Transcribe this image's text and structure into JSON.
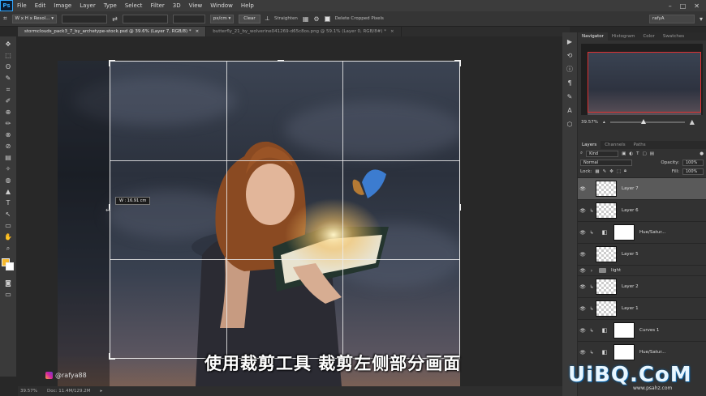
{
  "app": {
    "logo": "Ps"
  },
  "menu": [
    "File",
    "Edit",
    "Image",
    "Layer",
    "Type",
    "Select",
    "Filter",
    "3D",
    "View",
    "Window",
    "Help"
  ],
  "window_controls": [
    "–",
    "□",
    "✕"
  ],
  "options_bar": {
    "ratio_select": "W x H x Resol...",
    "unit_select": "px/cm",
    "clear_label": "Clear",
    "straighten_label": "Straighten",
    "delete_cropped_label": "Delete Cropped Pixels",
    "workspace_select": "rafyA"
  },
  "doc_tabs": [
    {
      "label": "stormclouds_pack3_7_by_archetype-stock.psd @ 39.6% (Layer 7, RGB/8) *",
      "close": "×",
      "active": true
    },
    {
      "label": "butterfly_21_by_wolverine041269-d65c8os.png @ 59.1% (Layer 0, RGB/8#) *",
      "close": "×",
      "active": false
    }
  ],
  "tools": [
    "✥",
    "⬚",
    "ʘ",
    "✎",
    "⌗",
    "✐",
    "⊕",
    "✏",
    "⊗",
    "⊘",
    "▤",
    "✧",
    "◍",
    "▲",
    "T",
    "↖",
    "▭",
    "✋",
    "⌕"
  ],
  "colors": {
    "foreground": "#f5b82e",
    "background": "#ffffff",
    "crop_border": "#e6e6e6",
    "nav_viewbox": "#e03030"
  },
  "canvas": {
    "width_tooltip": "W : 16.91 cm",
    "subtitle": "使用裁剪工具 裁剪左侧部分画面",
    "author_handle": "@rafya88"
  },
  "status": {
    "zoom": "39.57%",
    "doc": "Doc: 11.4M/129.2M"
  },
  "panel_strip_icons": [
    "play-icon",
    "history-icon",
    "info-icon",
    "paragraph-icon",
    "brush-icon",
    "character-icon",
    "path-icon"
  ],
  "panel_strip_glyphs": [
    "▶",
    "⟲",
    "ⓘ",
    "¶",
    "✎",
    "A",
    "⬡"
  ],
  "navigator": {
    "tabs": [
      "Navigator",
      "Histogram",
      "Color",
      "Swatches"
    ],
    "zoom_value": "39.57%"
  },
  "layers_panel": {
    "tabs": [
      "Layers",
      "Channels",
      "Paths"
    ],
    "filter_select": "Kind",
    "blend_mode": "Normal",
    "opacity_label": "Opacity:",
    "opacity_value": "100%",
    "lock_label": "Lock:",
    "fill_label": "Fill:",
    "fill_value": "100%",
    "layers": [
      {
        "name": "Layer 7",
        "type": "pixel",
        "selected": true,
        "clipped": false
      },
      {
        "name": "Layer 6",
        "type": "pixel",
        "selected": false,
        "clipped": true
      },
      {
        "name": "Hue/Satur...",
        "type": "adjustment",
        "selected": false,
        "clipped": true
      },
      {
        "name": "Layer 5",
        "type": "pixel",
        "selected": false,
        "clipped": false
      },
      {
        "name": "light",
        "type": "group",
        "selected": false,
        "clipped": false
      },
      {
        "name": "Layer 2",
        "type": "pixel",
        "selected": false,
        "clipped": true
      },
      {
        "name": "Layer 1",
        "type": "pixel",
        "selected": false,
        "clipped": true
      },
      {
        "name": "Curves 1",
        "type": "adjustment",
        "selected": false,
        "clipped": true
      },
      {
        "name": "Hue/Satur...",
        "type": "adjustment",
        "selected": false,
        "clipped": true
      }
    ]
  },
  "watermark": {
    "text": "UiBQ.CoM",
    "sub": "www.psahz.com"
  }
}
